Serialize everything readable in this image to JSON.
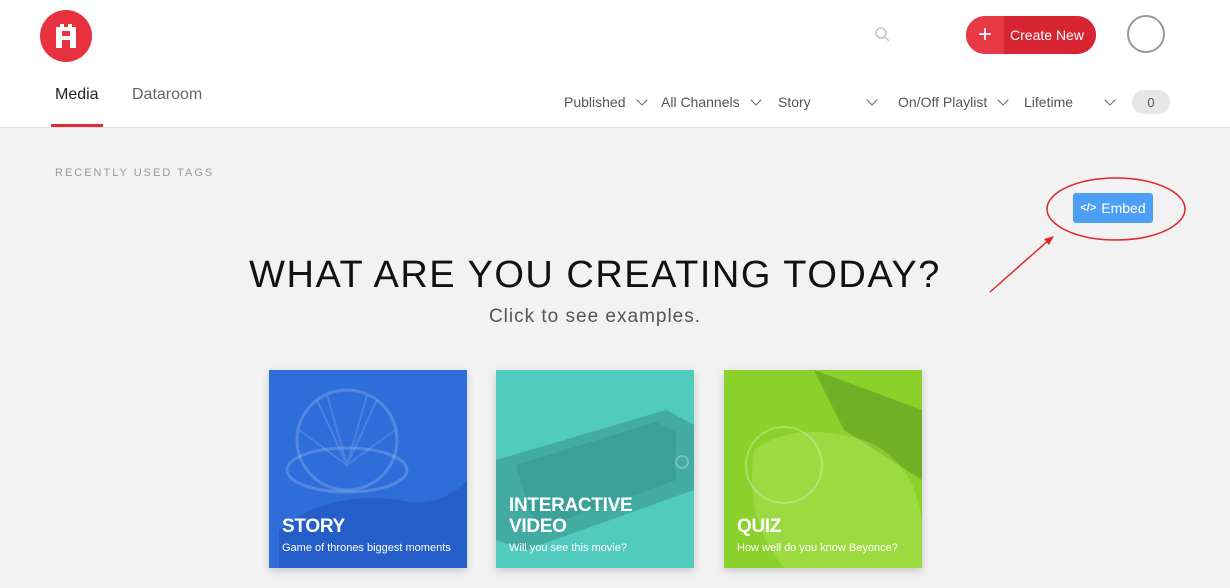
{
  "header": {
    "create_new_label": "Create New",
    "create_new_plus": "+",
    "tabs": [
      {
        "label": "Media"
      },
      {
        "label": "Dataroom"
      }
    ],
    "filters": [
      {
        "label": "Published"
      },
      {
        "label": "All Channels"
      },
      {
        "label": "Story"
      },
      {
        "label": "On/Off Playlist"
      },
      {
        "label": "Lifetime"
      }
    ],
    "result_count": "0"
  },
  "main": {
    "recent_tags_label": "RECENTLY USED TAGS",
    "embed_label": "Embed",
    "embed_icon_glyph": "</>",
    "headline": "WHAT ARE YOU CREATING TODAY?",
    "subheadline": "Click to see examples.",
    "cards": [
      {
        "title": "STORY",
        "subtitle": "Game of thrones biggest moments",
        "color": "#2f6edb"
      },
      {
        "title": "INTERACTIVE VIDEO",
        "subtitle": "Will you see this movie?",
        "color": "#52cbbf"
      },
      {
        "title": "QUIZ",
        "subtitle": "How well do you know Beyonce?",
        "color": "#8bd12b"
      }
    ]
  },
  "colors": {
    "brand_red": "#e32b37",
    "embed_blue": "#4d9ff5",
    "annotation_red": "#e0262b"
  },
  "icons": [
    "logo-icon",
    "search-icon",
    "plus-icon",
    "chevron-down-icon",
    "code-icon"
  ]
}
